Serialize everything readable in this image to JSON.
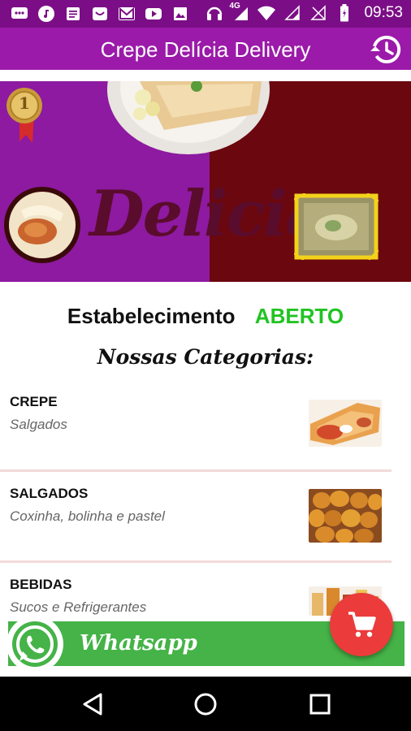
{
  "status_bar": {
    "time": "09:53",
    "network": "4G",
    "left_icons": [
      "message-icon",
      "music-icon",
      "note-icon",
      "bag-icon",
      "gmail-icon",
      "youtube-icon",
      "image-icon"
    ],
    "right_icons": [
      "headphones-icon",
      "signal-4g-icon",
      "wifi-icon",
      "signal-icon",
      "signal-empty-icon",
      "battery-icon"
    ],
    "color": "#7b0e86"
  },
  "app_bar": {
    "title": "Crepe Delícia Delivery",
    "history_icon": "history-icon",
    "color": "#9b1aa9"
  },
  "banner": {
    "word": "Delicia",
    "badge_number": "1"
  },
  "establishment": {
    "label": "Estabelecimento",
    "status": "ABERTO",
    "status_color": "#22c322"
  },
  "categories_title": "Nossas Categorias:",
  "categories": [
    {
      "name": "CREPE",
      "description": "Salgados"
    },
    {
      "name": "SALGADOS",
      "description": "Coxinha, bolinha e pastel"
    },
    {
      "name": "BEBIDAS",
      "description": "Sucos e Refrigerantes"
    }
  ],
  "whatsapp": {
    "label": "Whatsapp",
    "color": "#45b347"
  },
  "cart_fab": {
    "icon": "cart-icon",
    "color": "#ec3b3b"
  },
  "nav_bar": {
    "buttons": [
      "back-icon",
      "home-icon",
      "recents-icon"
    ]
  }
}
